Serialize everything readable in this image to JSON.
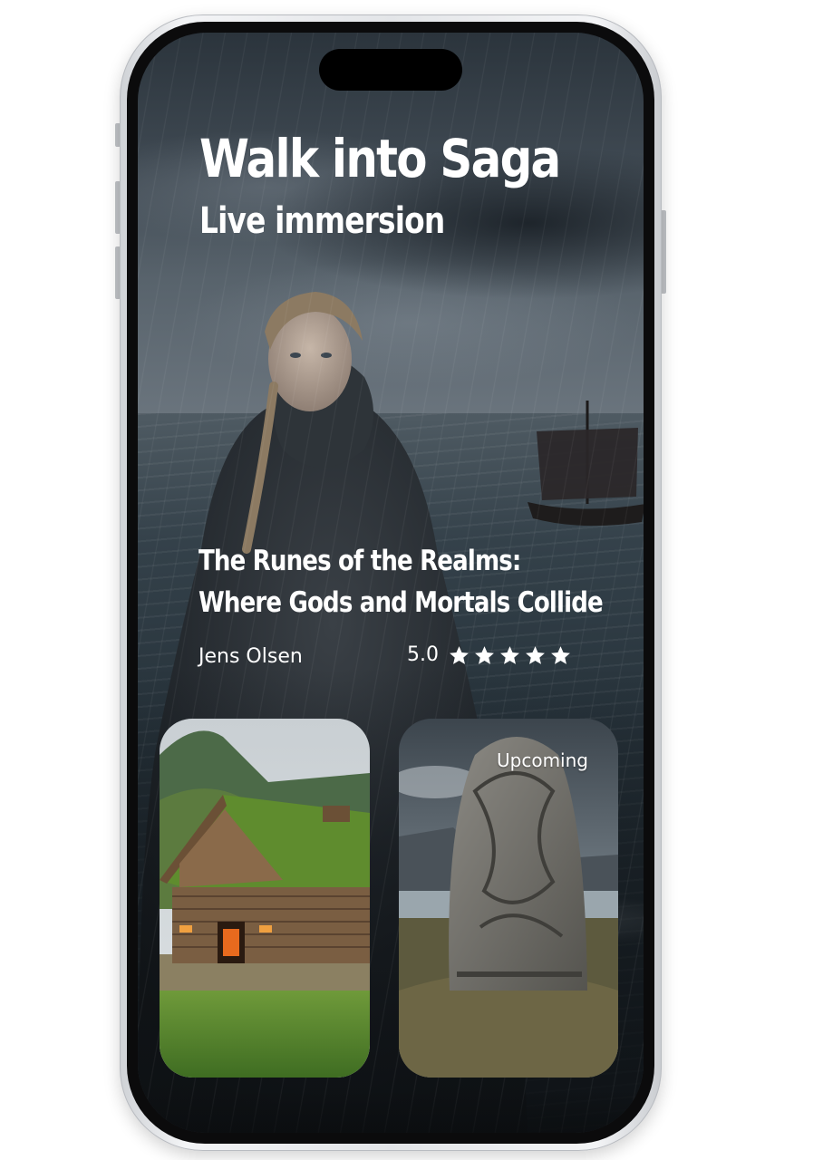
{
  "hero": {
    "title": "Walk into Saga",
    "subtitle": "Live immersion"
  },
  "featured": {
    "title_line1": "The Runes of the Realms:",
    "title_line2": "Where Gods and Mortals Collide",
    "author": "Jens Olsen",
    "rating": "5.0",
    "stars": 5
  },
  "cards": [
    {
      "image": "longhouse-photo"
    },
    {
      "image": "runestone-photo",
      "badge": "Upcoming"
    }
  ],
  "colors": {
    "text": "#ffffff",
    "background_dark": "#1c2329"
  }
}
